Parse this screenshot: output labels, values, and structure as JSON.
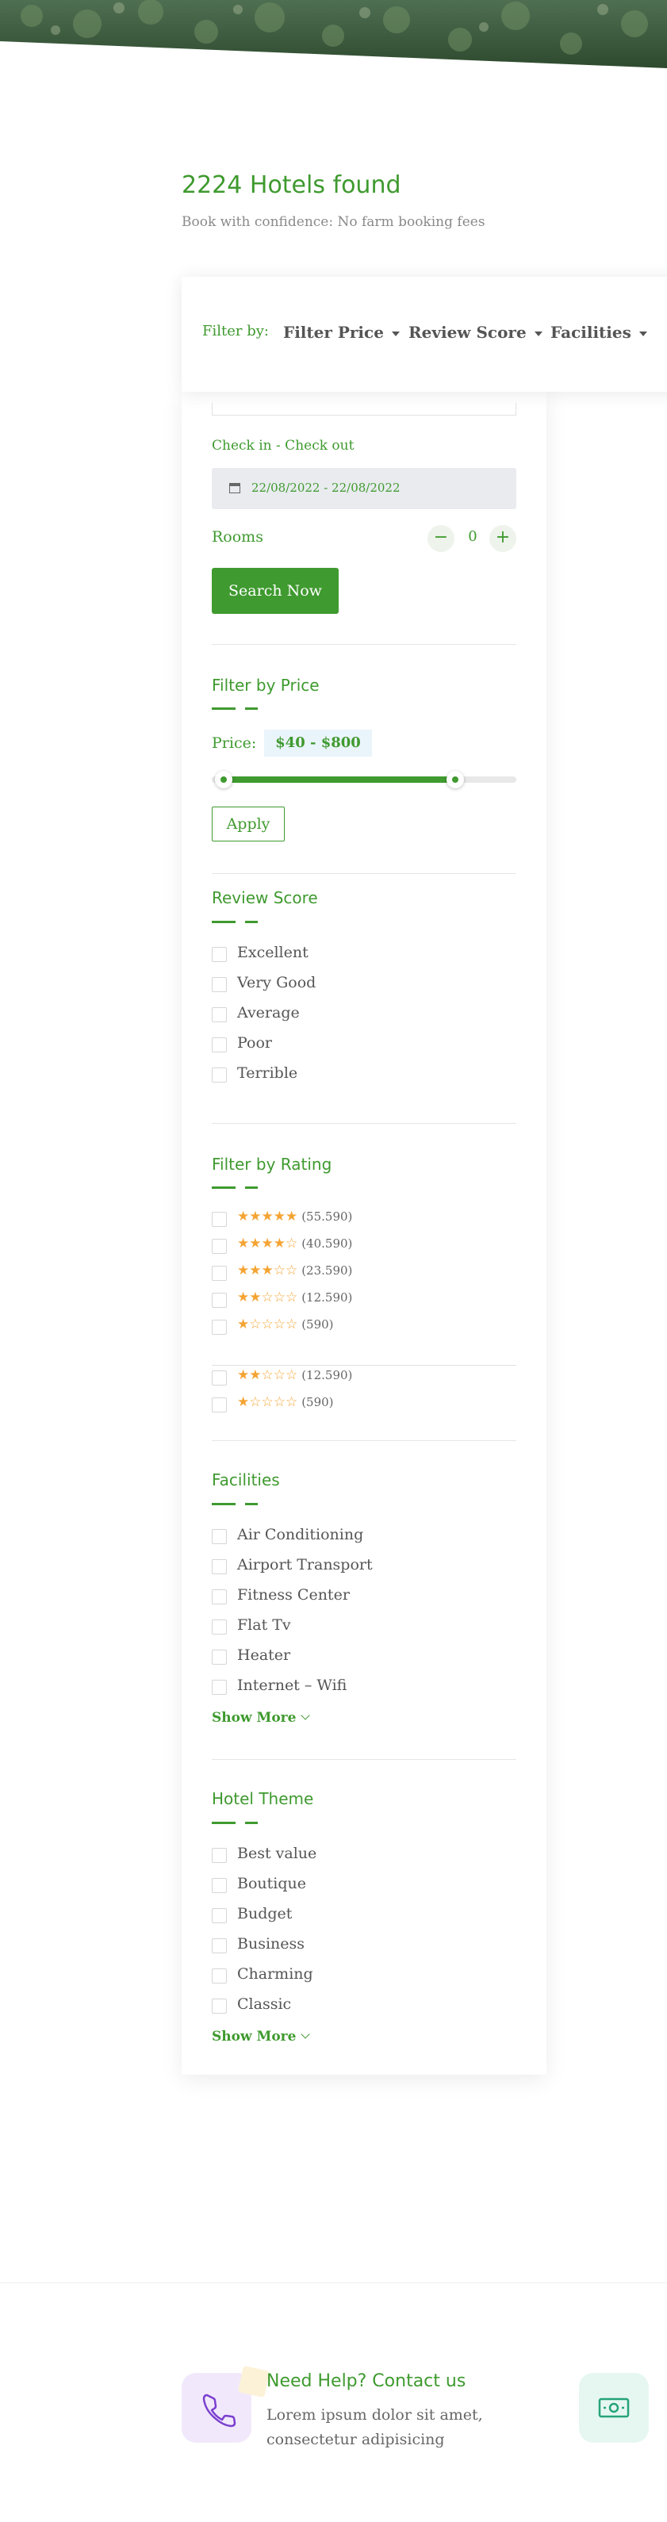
{
  "results": {
    "title": "2224 Hotels found",
    "subtitle": "Book with confidence: No farm booking fees"
  },
  "filter_bar": {
    "label": "Filter by:",
    "dropdowns": [
      "Filter Price",
      "Review Score",
      "Facilities"
    ]
  },
  "search_form": {
    "date_label": "Check in - Check out",
    "date_value": "22/08/2022 - 22/08/2022",
    "rooms_label": "Rooms",
    "rooms_value": "0",
    "decrement_symbol": "−",
    "increment_symbol": "+",
    "search_button": "Search Now"
  },
  "price_filter": {
    "title": "Filter by Price",
    "price_label": "Price:",
    "price_range": "$40 - $800",
    "range_min_fraction": 0.04,
    "range_max_fraction": 0.8,
    "apply_button": "Apply"
  },
  "review_score": {
    "title": "Review Score",
    "options": [
      "Excellent",
      "Very Good",
      "Average",
      "Poor",
      "Terrible"
    ]
  },
  "rating_filter": {
    "title": "Filter by Rating",
    "options": [
      {
        "stars": 5,
        "count": "(55.590)"
      },
      {
        "stars": 4,
        "count": "(40.590)"
      },
      {
        "stars": 3,
        "count": "(23.590)"
      },
      {
        "stars": 2,
        "count": "(12.590)"
      },
      {
        "stars": 1,
        "count": "(590)"
      }
    ],
    "overflow_options": [
      {
        "stars": 2,
        "count": "(12.590)"
      },
      {
        "stars": 1,
        "count": "(590)"
      }
    ]
  },
  "facilities": {
    "title": "Facilities",
    "options": [
      "Air Conditioning",
      "Airport Transport",
      "Fitness Center",
      "Flat Tv",
      "Heater",
      "Internet – Wifi"
    ],
    "show_more": "Show More"
  },
  "hotel_theme": {
    "title": "Hotel Theme",
    "options": [
      "Best value",
      "Boutique",
      "Budget",
      "Business",
      "Charming",
      "Classic"
    ],
    "show_more": "Show More"
  },
  "help": {
    "title": "Need Help? Contact us",
    "text": "Lorem ipsum dolor sit amet, consectetur adipisicing"
  },
  "colors": {
    "accent": "#3f9a2f",
    "star": "#f4a433",
    "phone_bg": "#f1e9fb",
    "money_bg": "#e6f7f1"
  },
  "icons": [
    "calendar-icon",
    "phone-icon",
    "money-icon",
    "caret-down-icon",
    "chevron-down-icon"
  ]
}
